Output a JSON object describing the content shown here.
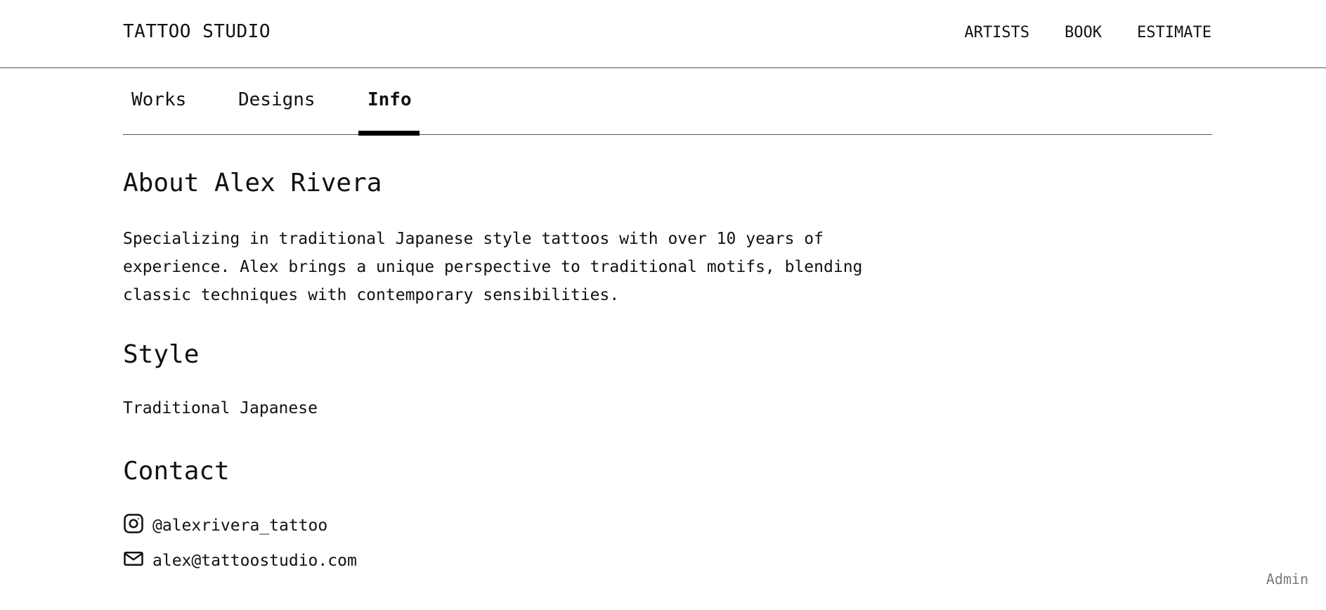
{
  "header": {
    "brand": "TATTOO STUDIO",
    "nav": {
      "artists": "ARTISTS",
      "book": "BOOK",
      "estimate": "ESTIMATE"
    }
  },
  "tabs": {
    "works": "Works",
    "designs": "Designs",
    "info": "Info",
    "active": "Info"
  },
  "about": {
    "title": "About Alex Rivera",
    "text": "Specializing in traditional Japanese style tattoos with over 10 years of experience. Alex brings a unique perspective to traditional motifs, blending classic techniques with contemporary sensibilities."
  },
  "style": {
    "title": "Style",
    "value": "Traditional Japanese"
  },
  "contact": {
    "title": "Contact",
    "instagram": "@alexrivera_tattoo",
    "instagram_icon": "instagram-icon",
    "email": "alex@tattoostudio.com",
    "email_icon": "mail-icon"
  },
  "footer": {
    "admin": "Admin"
  }
}
